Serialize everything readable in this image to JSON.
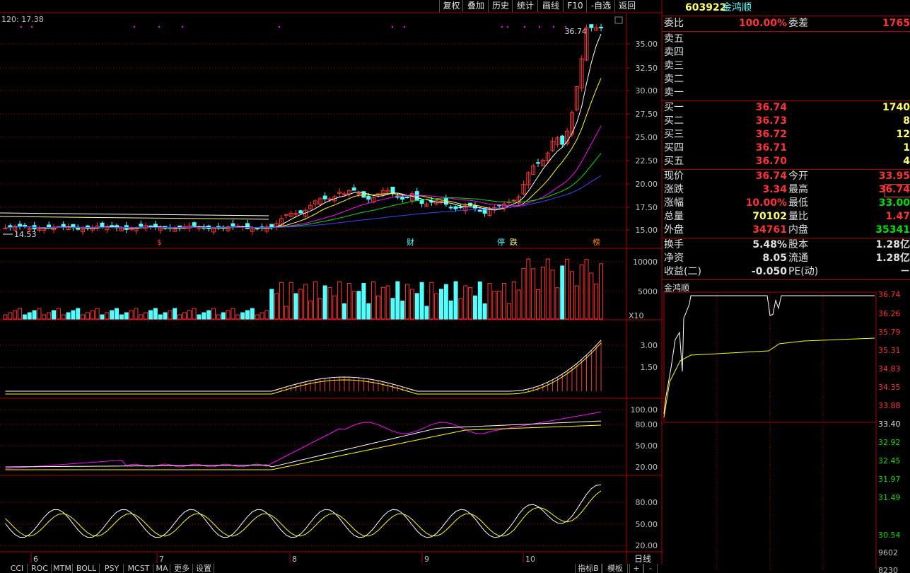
{
  "toolbar": {
    "buttons": [
      "复权",
      "叠加",
      "历史",
      "统计",
      "画线",
      "F10",
      "-自选",
      "返回"
    ]
  },
  "main_chart": {
    "ma_label": "120: 17.38",
    "high_label": "36.74",
    "low_label": "14.53",
    "price_ticks": [
      "35.00",
      "32.50",
      "30.00",
      "27.50",
      "25.00",
      "22.50",
      "20.00",
      "17.50",
      "15.00"
    ],
    "markers": [
      "$",
      "财",
      "停",
      "跌",
      "榜"
    ]
  },
  "volume_chart": {
    "ticks": [
      "10000",
      "5000"
    ],
    "unit": "X10"
  },
  "indicator1": {
    "ticks": [
      "3.00",
      "1.50"
    ]
  },
  "indicator2": {
    "ticks": [
      "100.00",
      "80.00",
      "50.00",
      "20.00"
    ]
  },
  "indicator3": {
    "ticks": [
      "80.00",
      "50.00",
      "20.00"
    ]
  },
  "x_axis": {
    "months": [
      "6",
      "7",
      "8",
      "9",
      "10"
    ],
    "period": "日线"
  },
  "bottom_tabs": {
    "left": [
      "CCI",
      "ROC",
      "MTM",
      "BOLL",
      "PSY",
      "MCST",
      "MA",
      "更多",
      "设置"
    ],
    "right": [
      "指标B",
      "模板",
      "+",
      "-"
    ]
  },
  "quote": {
    "code": "603922",
    "name": "金鸿顺",
    "wei_bi_label": "委比",
    "wei_bi": "100.00%",
    "wei_cha_label": "委差",
    "wei_cha": "1765",
    "sell": [
      {
        "label": "卖五",
        "price": "",
        "vol": ""
      },
      {
        "label": "卖四",
        "price": "",
        "vol": ""
      },
      {
        "label": "卖三",
        "price": "",
        "vol": ""
      },
      {
        "label": "卖二",
        "price": "",
        "vol": ""
      },
      {
        "label": "卖一",
        "price": "",
        "vol": ""
      }
    ],
    "buy": [
      {
        "label": "买一",
        "price": "36.74",
        "vol": "1740"
      },
      {
        "label": "买二",
        "price": "36.73",
        "vol": "8"
      },
      {
        "label": "买三",
        "price": "36.72",
        "vol": "12"
      },
      {
        "label": "买四",
        "price": "36.71",
        "vol": "1"
      },
      {
        "label": "买五",
        "price": "36.70",
        "vol": "4"
      }
    ],
    "stats": [
      {
        "l1": "现价",
        "v1": "36.74",
        "l2": "今开",
        "v2": "33.95"
      },
      {
        "l1": "涨跌",
        "v1": "3.34",
        "l2": "最高",
        "v2": "36.74"
      },
      {
        "l1": "涨幅",
        "v1": "10.00%",
        "l2": "最低",
        "v2": "33.00"
      },
      {
        "l1": "总量",
        "v1": "70102",
        "l2": "量比",
        "v2": "1.47"
      },
      {
        "l1": "外盘",
        "v1": "34761",
        "l2": "内盘",
        "v2": "35341"
      }
    ],
    "stats2": [
      {
        "l1": "换手",
        "v1": "5.48%",
        "l2": "股本",
        "v2": "1.28亿"
      },
      {
        "l1": "净资",
        "v1": "8.05",
        "l2": "流通",
        "v2": "1.28亿"
      },
      {
        "l1": "收益(二)",
        "v1": "-0.050",
        "l2": "PE(动)",
        "v2": "－"
      }
    ]
  },
  "intraday": {
    "title": "金鸿顺",
    "ticks": [
      "36.74",
      "36.26",
      "35.79",
      "35.31",
      "34.83",
      "34.35",
      "33.88",
      "33.40",
      "32.92",
      "32.45",
      "31.97",
      "31.49",
      "30.54",
      "9602",
      "8230"
    ]
  },
  "colors": {
    "up": "#ff3232",
    "down": "#54ffff",
    "grid": "#b00000",
    "yellow": "#ffff00",
    "white": "#ffffff",
    "magenta": "#ff00ff",
    "green": "#00e000"
  }
}
